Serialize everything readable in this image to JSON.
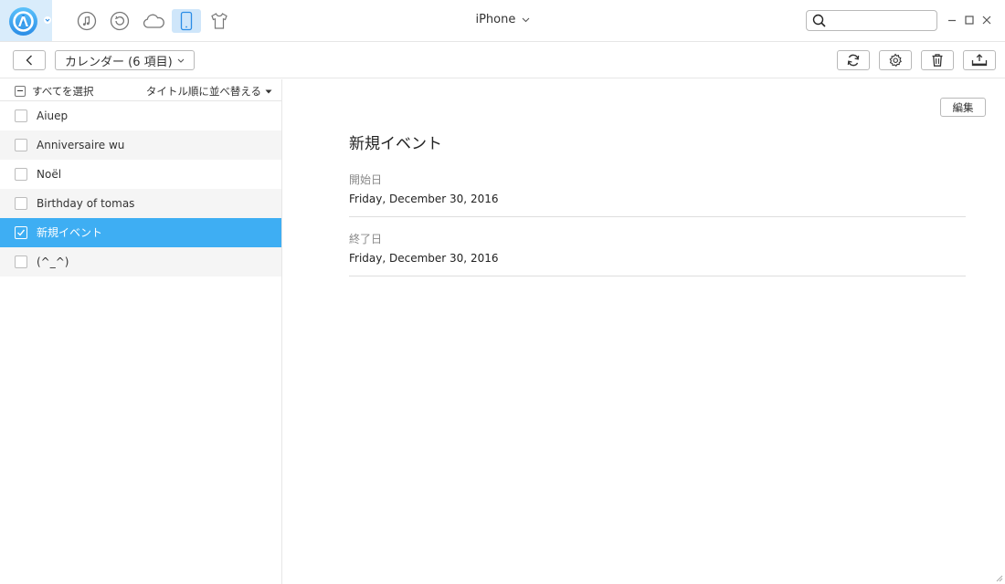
{
  "colors": {
    "accent": "#3eaef3",
    "logo": "#2b8de6",
    "active_nav_bg": "#cfe6fa",
    "row_alt": "#f5f5f5"
  },
  "topbar": {
    "logo_icon": "anytrans-logo-icon",
    "nav_icons": [
      "music-icon",
      "restore-icon",
      "cloud-icon",
      "phone-icon",
      "tshirt-icon"
    ],
    "active_nav": "phone-icon",
    "device_name": "iPhone",
    "search": {
      "value": "",
      "placeholder": ""
    }
  },
  "toolbar": {
    "category_label": "カレンダー (6 項目)",
    "tool_icons": [
      "refresh-icon",
      "settings-icon",
      "trash-icon",
      "export-icon"
    ]
  },
  "list": {
    "select_all_label": "すべてを選択",
    "sort_label": "タイトル順に並べ替える",
    "items": [
      {
        "label": "Aiuep",
        "checked": false
      },
      {
        "label": "Anniversaire wu",
        "checked": false
      },
      {
        "label": "Noël",
        "checked": false
      },
      {
        "label": "Birthday of tomas",
        "checked": false
      },
      {
        "label": "新規イベント",
        "checked": true
      },
      {
        "label": "(^_^)",
        "checked": false
      }
    ]
  },
  "detail": {
    "edit_label": "編集",
    "title": "新規イベント",
    "start_label": "開始日",
    "start_value": "Friday, December 30, 2016",
    "end_label": "終了日",
    "end_value": "Friday, December 30, 2016"
  }
}
